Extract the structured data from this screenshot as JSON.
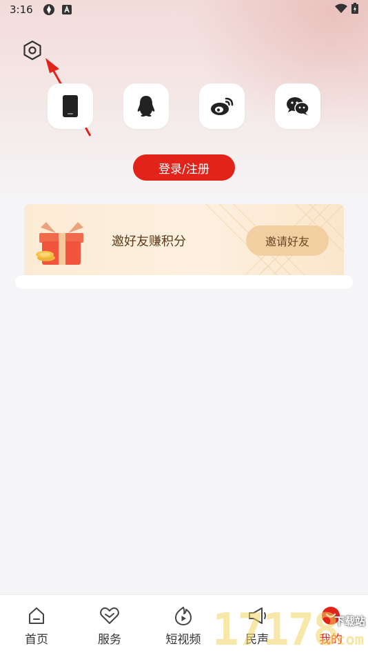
{
  "status_bar": {
    "time": "3:16"
  },
  "login": {
    "register_button": "登录/注册",
    "methods": [
      {
        "name": "phone-icon"
      },
      {
        "name": "qq-icon"
      },
      {
        "name": "weibo-icon"
      },
      {
        "name": "wechat-icon"
      }
    ]
  },
  "invite": {
    "text": "邀好友赚积分",
    "button": "邀请好友"
  },
  "tabs": [
    {
      "label": "首页",
      "icon": "home-icon"
    },
    {
      "label": "服务",
      "icon": "service-icon"
    },
    {
      "label": "短视频",
      "icon": "video-icon"
    },
    {
      "label": "民声",
      "icon": "megaphone-icon"
    },
    {
      "label": "我的",
      "icon": "profile-icon",
      "active": true
    }
  ],
  "watermark": {
    "digits": "17178",
    "site": "下载站",
    "com": "com"
  },
  "colors": {
    "accent": "#e2231a",
    "invite_button": "#f1cfa1",
    "invite_text": "#5b3a1c"
  }
}
